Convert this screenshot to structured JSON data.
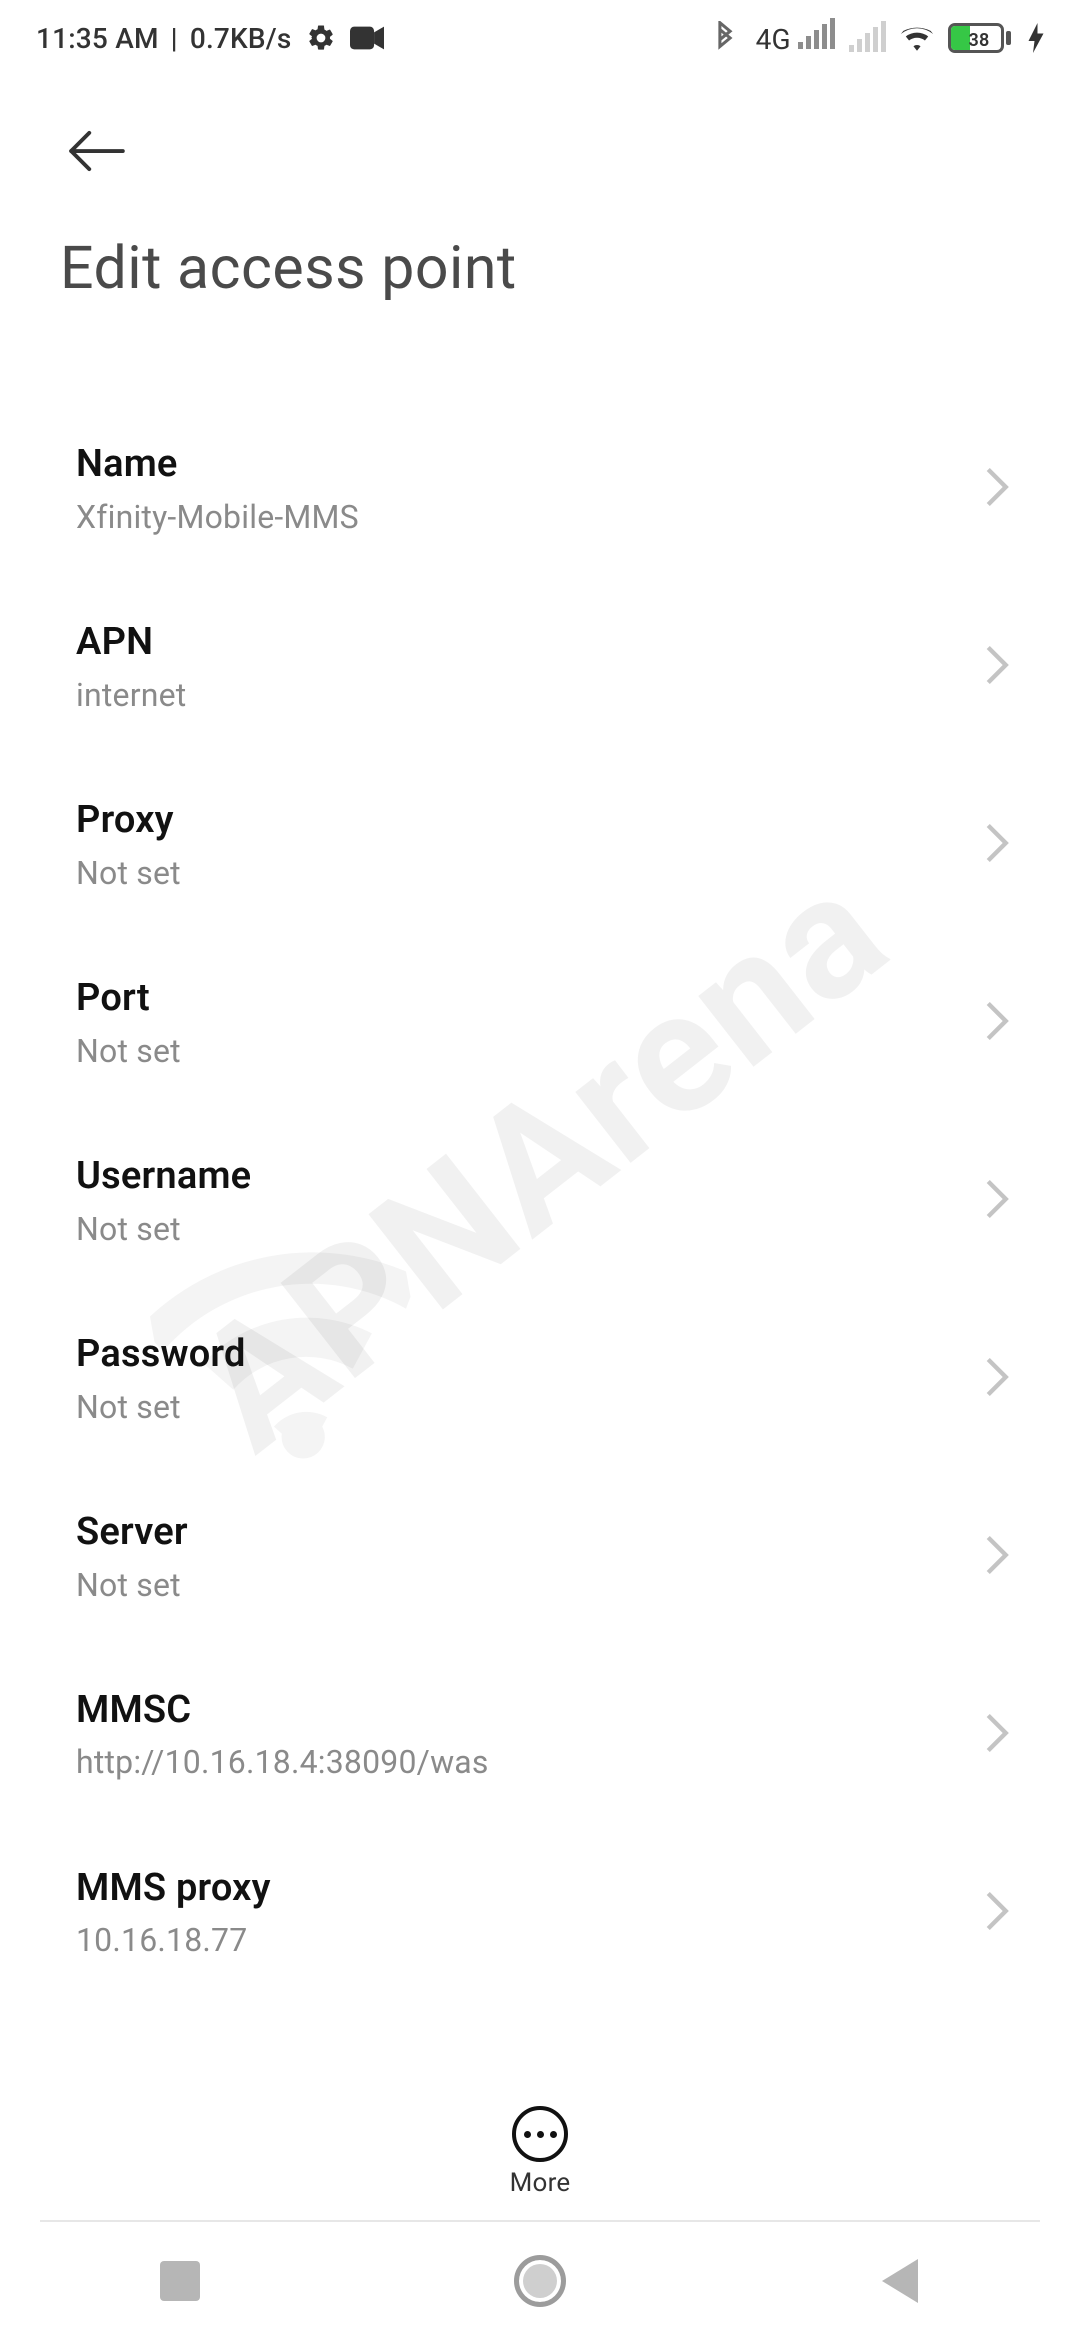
{
  "statusbar": {
    "time": "11:35 AM",
    "sep": "|",
    "datarate": "0.7KB/s",
    "network_label": "4G",
    "battery_pct": "38"
  },
  "header": {
    "title": "Edit access point"
  },
  "rows": [
    {
      "label": "Name",
      "value": "Xfinity-Mobile-MMS"
    },
    {
      "label": "APN",
      "value": "internet"
    },
    {
      "label": "Proxy",
      "value": "Not set"
    },
    {
      "label": "Port",
      "value": "Not set"
    },
    {
      "label": "Username",
      "value": "Not set"
    },
    {
      "label": "Password",
      "value": "Not set"
    },
    {
      "label": "Server",
      "value": "Not set"
    },
    {
      "label": "MMSC",
      "value": "http://10.16.18.4:38090/was"
    },
    {
      "label": "MMS proxy",
      "value": "10.16.18.77"
    }
  ],
  "more": {
    "label": "More"
  },
  "watermark": {
    "text": "APNArena"
  }
}
